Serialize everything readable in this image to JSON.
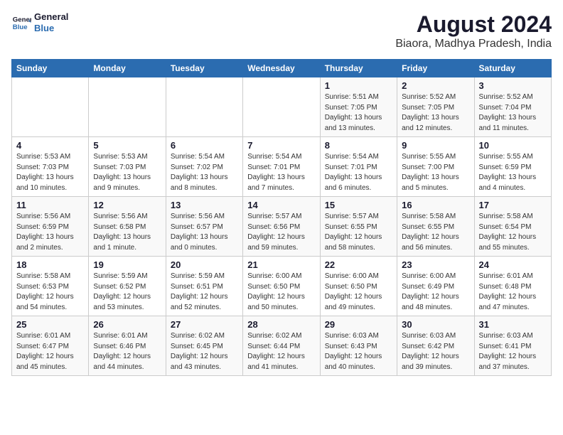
{
  "header": {
    "logo_line1": "General",
    "logo_line2": "Blue",
    "main_title": "August 2024",
    "subtitle": "Biaora, Madhya Pradesh, India"
  },
  "weekdays": [
    "Sunday",
    "Monday",
    "Tuesday",
    "Wednesday",
    "Thursday",
    "Friday",
    "Saturday"
  ],
  "weeks": [
    [
      {
        "day": "",
        "info": ""
      },
      {
        "day": "",
        "info": ""
      },
      {
        "day": "",
        "info": ""
      },
      {
        "day": "",
        "info": ""
      },
      {
        "day": "1",
        "info": "Sunrise: 5:51 AM\nSunset: 7:05 PM\nDaylight: 13 hours\nand 13 minutes."
      },
      {
        "day": "2",
        "info": "Sunrise: 5:52 AM\nSunset: 7:05 PM\nDaylight: 13 hours\nand 12 minutes."
      },
      {
        "day": "3",
        "info": "Sunrise: 5:52 AM\nSunset: 7:04 PM\nDaylight: 13 hours\nand 11 minutes."
      }
    ],
    [
      {
        "day": "4",
        "info": "Sunrise: 5:53 AM\nSunset: 7:03 PM\nDaylight: 13 hours\nand 10 minutes."
      },
      {
        "day": "5",
        "info": "Sunrise: 5:53 AM\nSunset: 7:03 PM\nDaylight: 13 hours\nand 9 minutes."
      },
      {
        "day": "6",
        "info": "Sunrise: 5:54 AM\nSunset: 7:02 PM\nDaylight: 13 hours\nand 8 minutes."
      },
      {
        "day": "7",
        "info": "Sunrise: 5:54 AM\nSunset: 7:01 PM\nDaylight: 13 hours\nand 7 minutes."
      },
      {
        "day": "8",
        "info": "Sunrise: 5:54 AM\nSunset: 7:01 PM\nDaylight: 13 hours\nand 6 minutes."
      },
      {
        "day": "9",
        "info": "Sunrise: 5:55 AM\nSunset: 7:00 PM\nDaylight: 13 hours\nand 5 minutes."
      },
      {
        "day": "10",
        "info": "Sunrise: 5:55 AM\nSunset: 6:59 PM\nDaylight: 13 hours\nand 4 minutes."
      }
    ],
    [
      {
        "day": "11",
        "info": "Sunrise: 5:56 AM\nSunset: 6:59 PM\nDaylight: 13 hours\nand 2 minutes."
      },
      {
        "day": "12",
        "info": "Sunrise: 5:56 AM\nSunset: 6:58 PM\nDaylight: 13 hours\nand 1 minute."
      },
      {
        "day": "13",
        "info": "Sunrise: 5:56 AM\nSunset: 6:57 PM\nDaylight: 13 hours\nand 0 minutes."
      },
      {
        "day": "14",
        "info": "Sunrise: 5:57 AM\nSunset: 6:56 PM\nDaylight: 12 hours\nand 59 minutes."
      },
      {
        "day": "15",
        "info": "Sunrise: 5:57 AM\nSunset: 6:55 PM\nDaylight: 12 hours\nand 58 minutes."
      },
      {
        "day": "16",
        "info": "Sunrise: 5:58 AM\nSunset: 6:55 PM\nDaylight: 12 hours\nand 56 minutes."
      },
      {
        "day": "17",
        "info": "Sunrise: 5:58 AM\nSunset: 6:54 PM\nDaylight: 12 hours\nand 55 minutes."
      }
    ],
    [
      {
        "day": "18",
        "info": "Sunrise: 5:58 AM\nSunset: 6:53 PM\nDaylight: 12 hours\nand 54 minutes."
      },
      {
        "day": "19",
        "info": "Sunrise: 5:59 AM\nSunset: 6:52 PM\nDaylight: 12 hours\nand 53 minutes."
      },
      {
        "day": "20",
        "info": "Sunrise: 5:59 AM\nSunset: 6:51 PM\nDaylight: 12 hours\nand 52 minutes."
      },
      {
        "day": "21",
        "info": "Sunrise: 6:00 AM\nSunset: 6:50 PM\nDaylight: 12 hours\nand 50 minutes."
      },
      {
        "day": "22",
        "info": "Sunrise: 6:00 AM\nSunset: 6:50 PM\nDaylight: 12 hours\nand 49 minutes."
      },
      {
        "day": "23",
        "info": "Sunrise: 6:00 AM\nSunset: 6:49 PM\nDaylight: 12 hours\nand 48 minutes."
      },
      {
        "day": "24",
        "info": "Sunrise: 6:01 AM\nSunset: 6:48 PM\nDaylight: 12 hours\nand 47 minutes."
      }
    ],
    [
      {
        "day": "25",
        "info": "Sunrise: 6:01 AM\nSunset: 6:47 PM\nDaylight: 12 hours\nand 45 minutes."
      },
      {
        "day": "26",
        "info": "Sunrise: 6:01 AM\nSunset: 6:46 PM\nDaylight: 12 hours\nand 44 minutes."
      },
      {
        "day": "27",
        "info": "Sunrise: 6:02 AM\nSunset: 6:45 PM\nDaylight: 12 hours\nand 43 minutes."
      },
      {
        "day": "28",
        "info": "Sunrise: 6:02 AM\nSunset: 6:44 PM\nDaylight: 12 hours\nand 41 minutes."
      },
      {
        "day": "29",
        "info": "Sunrise: 6:03 AM\nSunset: 6:43 PM\nDaylight: 12 hours\nand 40 minutes."
      },
      {
        "day": "30",
        "info": "Sunrise: 6:03 AM\nSunset: 6:42 PM\nDaylight: 12 hours\nand 39 minutes."
      },
      {
        "day": "31",
        "info": "Sunrise: 6:03 AM\nSunset: 6:41 PM\nDaylight: 12 hours\nand 37 minutes."
      }
    ]
  ]
}
